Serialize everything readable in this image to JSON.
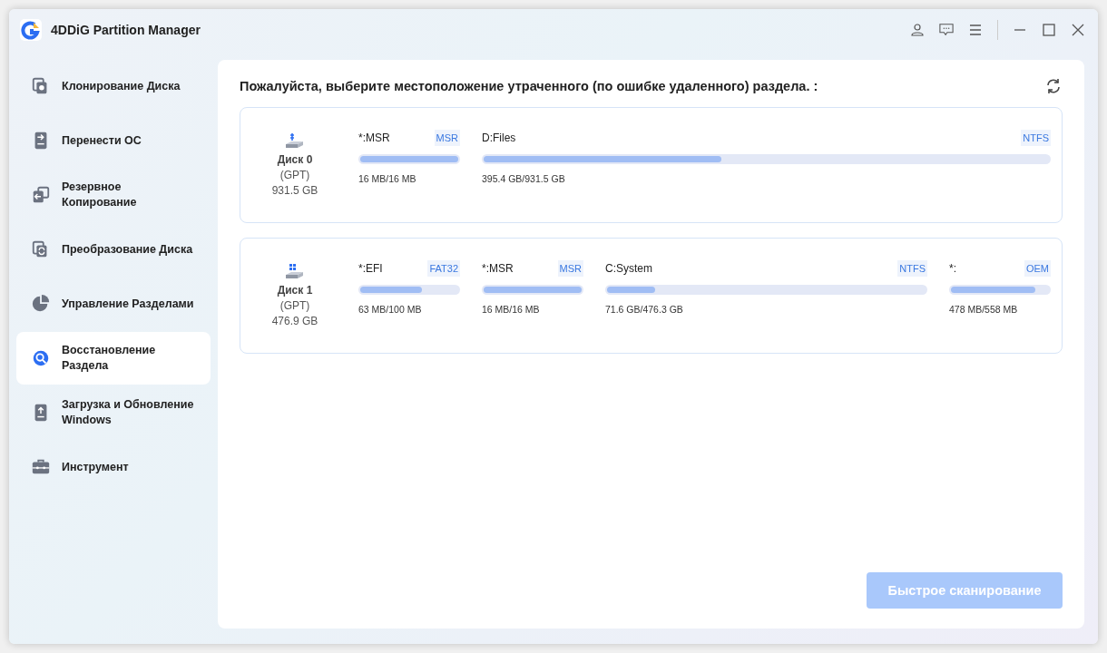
{
  "window": {
    "title": "4DDiG Partition Manager"
  },
  "sidebar": {
    "items": [
      {
        "label": "Клонирование Диска",
        "selected": false
      },
      {
        "label": "Перенести ОС",
        "selected": false
      },
      {
        "label": "Резервное Копирование",
        "selected": false
      },
      {
        "label": "Преобразование Диска",
        "selected": false
      },
      {
        "label": "Управление Разделами",
        "selected": false
      },
      {
        "label": "Восстановление Раздела",
        "selected": true
      },
      {
        "label": "Загрузка и Обновление Windows",
        "selected": false
      },
      {
        "label": "Инструмент",
        "selected": false
      }
    ]
  },
  "main": {
    "heading": "Пожалуйста, выберите местоположение утраченного (по ошибке удаленного) раздела. :",
    "disks": [
      {
        "name": "Диск 0",
        "scheme": "(GPT)",
        "size": "931.5 GB",
        "kind": "usb",
        "partitions": [
          {
            "label": "*:MSR",
            "fs": "MSR",
            "usage": "16 MB/16 MB",
            "level": 1,
            "kind": "small"
          },
          {
            "label": "D:Files",
            "fs": "NTFS",
            "usage": "395.4 GB/931.5 GB",
            "level": 0.42,
            "kind": "large"
          }
        ]
      },
      {
        "name": "Диск 1",
        "scheme": "(GPT)",
        "size": "476.9 GB",
        "kind": "system",
        "partitions": [
          {
            "label": "*:EFI",
            "fs": "FAT32",
            "usage": "63 MB/100 MB",
            "level": 0.63,
            "kind": "small"
          },
          {
            "label": "*:MSR",
            "fs": "MSR",
            "usage": "16 MB/16 MB",
            "level": 1,
            "kind": "small"
          },
          {
            "label": "C:System",
            "fs": "NTFS",
            "usage": "71.6 GB/476.3 GB",
            "level": 0.15,
            "kind": "large"
          },
          {
            "label": "*:",
            "fs": "OEM",
            "usage": "478 MB/558 MB",
            "level": 0.86,
            "kind": "small"
          }
        ]
      }
    ],
    "scan_button": {
      "label": "Быстрое сканирование",
      "disabled": true
    }
  }
}
